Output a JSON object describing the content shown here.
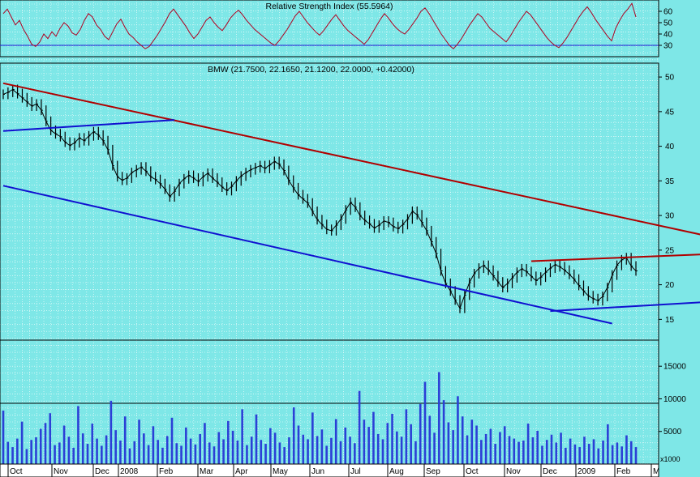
{
  "colors": {
    "background": "#7ee7e7",
    "grid": "#ffffff",
    "rsi_line": "#b00020",
    "price_bars": "#000000",
    "volume_bars": "#2b3fd6",
    "resistance_line": "#b00000",
    "support_line": "#1010d0",
    "frame": "#000000"
  },
  "chart_data": [
    {
      "type": "line",
      "title": "Relative Strength Index (55.5964)",
      "y_ticks": [
        "60",
        "50",
        "40",
        "30"
      ],
      "ylim": [
        20,
        70
      ],
      "reference_level": 30,
      "series": [
        {
          "values": [
            58,
            62,
            55,
            48,
            52,
            44,
            38,
            31,
            29,
            33,
            40,
            36,
            42,
            38,
            45,
            50,
            47,
            41,
            39,
            44,
            52,
            58,
            55,
            48,
            44,
            38,
            35,
            42,
            49,
            53,
            46,
            40,
            37,
            33,
            30,
            27,
            29,
            34,
            39,
            45,
            51,
            58,
            62,
            57,
            52,
            47,
            41,
            36,
            40,
            46,
            52,
            55,
            50,
            46,
            43,
            48,
            54,
            58,
            61,
            57,
            52,
            48,
            44,
            41,
            38,
            35,
            32,
            30,
            34,
            39,
            44,
            50,
            56,
            60,
            55,
            50,
            46,
            42,
            39,
            43,
            48,
            53,
            57,
            52,
            47,
            43,
            40,
            37,
            34,
            31,
            35,
            41,
            47,
            53,
            58,
            54,
            49,
            45,
            42,
            40,
            44,
            49,
            54,
            60,
            63,
            58,
            52,
            46,
            40,
            35,
            30,
            27,
            31,
            36,
            42,
            48,
            53,
            58,
            55,
            50,
            45,
            42,
            39,
            36,
            33,
            38,
            44,
            50,
            55,
            60,
            57,
            52,
            47,
            42,
            37,
            33,
            30,
            28,
            32,
            37,
            43,
            49,
            55,
            60,
            64,
            59,
            53,
            48,
            43,
            38,
            34,
            45,
            52,
            58,
            62,
            67,
            55
          ]
        }
      ]
    },
    {
      "type": "line",
      "title": "BMW (21.7500, 22.1650, 21.1200, 22.0000, +0.42000)",
      "x_ticks": [
        "Oct",
        "Nov",
        "Dec",
        "2008",
        "Feb",
        "Mar",
        "Apr",
        "May",
        "Jun",
        "Jul",
        "Aug",
        "Sep",
        "Oct",
        "Nov",
        "Dec",
        "2009",
        "Feb",
        "M"
      ],
      "y_ticks": [
        "50",
        "45",
        "40",
        "35",
        "30",
        "25",
        "20",
        "15"
      ],
      "ylim": [
        12,
        52
      ],
      "series": [
        {
          "values": [
            47.5,
            47.8,
            48.2,
            47.6,
            47.0,
            46.4,
            45.8,
            46.1,
            45.2,
            43.6,
            42.3,
            41.8,
            41.4,
            40.6,
            40.1,
            40.5,
            41.2,
            40.8,
            41.5,
            42.1,
            41.6,
            40.8,
            39.5,
            37.2,
            35.6,
            35.1,
            35.4,
            36.2,
            36.6,
            37.0,
            36.4,
            35.6,
            35.2,
            34.6,
            33.8,
            32.7,
            33.5,
            34.6,
            35.3,
            35.8,
            35.4,
            34.9,
            35.6,
            36.1,
            35.4,
            34.8,
            34.1,
            33.6,
            34.2,
            35.0,
            35.7,
            36.2,
            36.6,
            36.9,
            37.2,
            36.8,
            37.3,
            37.8,
            37.4,
            36.5,
            35.1,
            34.0,
            33.0,
            32.4,
            31.8,
            30.6,
            29.4,
            28.7,
            28.0,
            27.8,
            28.6,
            29.5,
            30.8,
            31.9,
            31.2,
            30.0,
            29.3,
            28.8,
            28.2,
            28.6,
            29.2,
            29.0,
            28.4,
            28.1,
            28.7,
            29.5,
            30.6,
            30.1,
            29.0,
            27.8,
            26.2,
            24.5,
            22.0,
            20.2,
            19.1,
            17.8,
            16.6,
            18.5,
            20.3,
            21.6,
            22.4,
            22.8,
            22.1,
            21.3,
            20.4,
            19.6,
            20.2,
            21.0,
            21.8,
            22.3,
            21.9,
            21.2,
            20.6,
            21.1,
            21.8,
            22.4,
            22.9,
            22.6,
            22.1,
            21.5,
            20.8,
            19.9,
            19.1,
            18.4,
            18.0,
            17.7,
            18.3,
            19.6,
            21.4,
            22.8,
            23.6,
            23.9,
            22.7,
            22.0
          ]
        }
      ],
      "trendlines": [
        {
          "name": "resistance",
          "color": "#b00000",
          "points": [
            [
              0,
              49.1
            ],
            [
              155,
              26.0
            ]
          ]
        },
        {
          "name": "lower-support",
          "color": "#1010d0",
          "points": [
            [
              0,
              34.3
            ],
            [
              128,
              14.4
            ]
          ]
        },
        {
          "name": "upper-support",
          "color": "#1010d0",
          "points": [
            [
              0,
              42.2
            ],
            [
              36,
              43.8
            ]
          ]
        },
        {
          "name": "range-top",
          "color": "#b00000",
          "points": [
            [
              111,
              23.4
            ],
            [
              155,
              24.6
            ]
          ]
        },
        {
          "name": "range-bottom",
          "color": "#1010d0",
          "points": [
            [
              115,
              16.2
            ],
            [
              155,
              17.8
            ]
          ]
        }
      ]
    },
    {
      "type": "bar",
      "title": "",
      "y_ticks": [
        "15000",
        "10000",
        "5000"
      ],
      "unit_label": "x1000",
      "ylim": [
        0,
        19000
      ],
      "values": [
        8200,
        3400,
        2600,
        3900,
        6500,
        2300,
        3700,
        4100,
        5400,
        6300,
        7800,
        2900,
        3300,
        5900,
        4200,
        2500,
        8900,
        4700,
        3100,
        6200,
        3900,
        2800,
        4400,
        9700,
        5200,
        3600,
        7300,
        2400,
        3500,
        6800,
        4700,
        2900,
        5800,
        3700,
        2500,
        4300,
        7100,
        3200,
        2800,
        5600,
        3900,
        3000,
        4600,
        6300,
        3300,
        2700,
        4900,
        3800,
        6600,
        5100,
        3600,
        8400,
        2900,
        4200,
        7600,
        3700,
        3100,
        5500,
        4800,
        3300,
        2600,
        4100,
        8700,
        5900,
        4500,
        3800,
        7900,
        4300,
        5300,
        2800,
        4000,
        6900,
        3500,
        5600,
        4200,
        3200,
        11200,
        6800,
        5700,
        8000,
        4600,
        3800,
        6300,
        7700,
        5000,
        4200,
        8400,
        6100,
        3500,
        9200,
        12600,
        7400,
        4800,
        14100,
        9800,
        6400,
        5200,
        10400,
        7300,
        4400,
        6800,
        5900,
        3700,
        4600,
        5400,
        3100,
        4900,
        5800,
        4300,
        3900,
        3400,
        3600,
        6200,
        4100,
        5100,
        2800,
        3700,
        4500,
        3300,
        4800,
        2500,
        3900,
        3000,
        2600,
        4200,
        3100,
        3800,
        2400,
        3600,
        6100,
        2900,
        3300,
        2700,
        4400,
        3500,
        2600
      ]
    }
  ]
}
